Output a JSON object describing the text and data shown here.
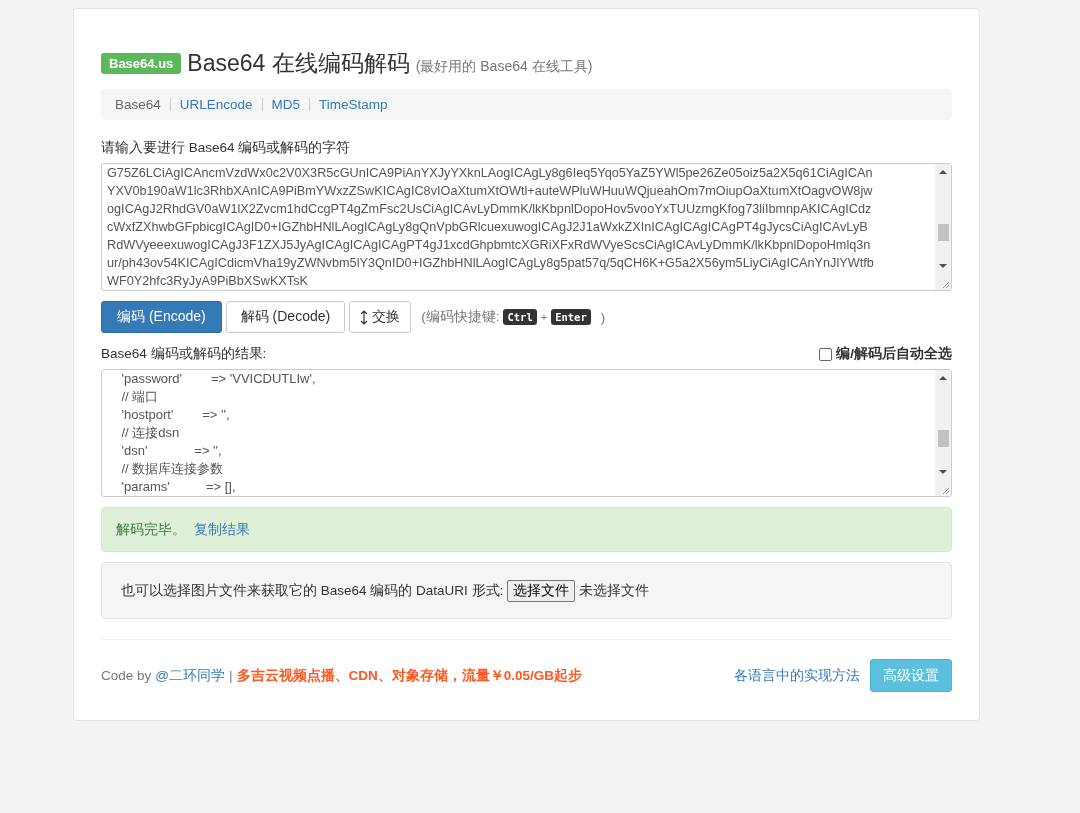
{
  "header": {
    "badge": "Base64.us",
    "title": "Base64 在线编码解码",
    "subtitle": "(最好用的 Base64 在线工具)"
  },
  "nav": [
    {
      "label": "Base64",
      "selected": true
    },
    {
      "label": "URLEncode",
      "selected": false
    },
    {
      "label": "MD5",
      "selected": false
    },
    {
      "label": "TimeStamp",
      "selected": false
    }
  ],
  "input": {
    "label": "请输入要进行 Base64 编码或解码的字符",
    "lines": [
      "G75Z6LCiAgICAncmVzdWx0c2V0X3R5cGUnICA9PiAnYXJyYXknLAogICAgLy8g6Ieq5Yqo5YaZ5YWl5pe26Ze05oiz5a2X5q61CiAgICAn",
      "YXV0b190aW1lc3RhbXAnICA9PiBmYWxzZSwKICAgIC8vIOaXtumXtOWtl+auteWPluWHuuWQjueahOm7mOiupOaXtumXtOagvOW8jw",
      "ogICAgJ2RhdGV0aW1lX2Zvcm1hdCcgPT4gZmFsc2UsCiAgICAvLyDmmK/lkKbpnlDopoHov5vooYxTUUzmgKfog73liIbmnpAKICAgICdz",
      "cWxfZXhwbGFpbicgICAgID0+IGZhbHNlLAogICAgLy8gQnVpbGRlcuexuwogICAgJ2J1aWxkZXInICAgICAgICAgPT4gJycsCiAgICAvLyB",
      "RdWVyeeexuwogICAgJ3F1ZXJ5JyAgICAgICAgICAgPT4gJ1xcdGhpbmtcXGRiXFxRdWVyeScsCiAgICAvLyDmmK/lkKbpnlDopoHmlq3n",
      "ur/ph43ov54KICAgICdicmVha19yZWNvbm5lY3QnID0+IGZhbHNlLAogICAgLy8g5pat57q/5qCH6K+G5a2X56ym5LiyCiAgICAnYnJlYWtfb",
      "WF0Y2hfc3RyJyA9PiBbXSwKXTsK"
    ]
  },
  "actions": {
    "buttons": [
      {
        "label": "编码 (Encode)",
        "kind": "primary"
      },
      {
        "label": "解码 (Decode)",
        "kind": "default"
      },
      {
        "label": "交换",
        "kind": "swap"
      }
    ],
    "hint_prefix": "(编码快捷键:",
    "keys": [
      "Ctrl",
      "Enter"
    ],
    "key_joiner": "+",
    "hint_suffix": ")"
  },
  "output": {
    "label": "Base64 编码或解码的结果:",
    "auto_select": {
      "label": "编/解码后自动全选",
      "checked": false
    },
    "lines": [
      "    'password'        => 'VVICDUTLIw',",
      "    // 端口",
      "    'hostport'        => '',",
      "    // 连接dsn",
      "    'dsn'             => '',",
      "    // 数据库连接参数",
      "    'params'          => [],"
    ]
  },
  "alert": {
    "message": "解码完毕。",
    "link": "复制结果"
  },
  "file_panel": {
    "text": "也可以选择图片文件来获取它的 Base64 编码的 DataURI 形式:",
    "button": "选择文件",
    "status": "未选择文件"
  },
  "footer": {
    "code_by": "Code by",
    "author": "@二环同学",
    "separator": "|",
    "promo": "多吉云视频点播、CDN、对象存储，流量￥0.05/GB起步",
    "link": "各语言中的实现方法",
    "button": "高级设置"
  }
}
